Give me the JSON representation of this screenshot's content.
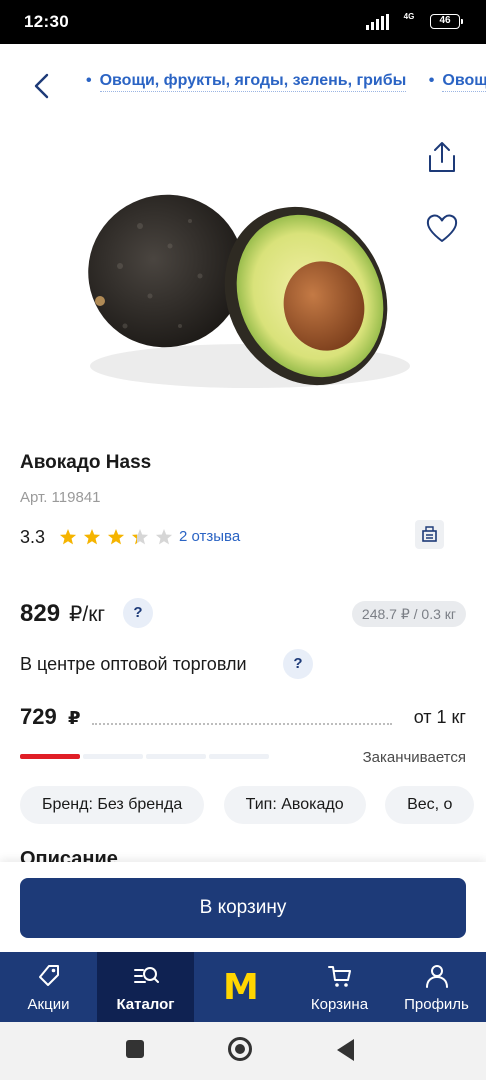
{
  "status": {
    "time": "12:30",
    "network": "4G",
    "battery": "46"
  },
  "breadcrumbs": [
    "Овощи, фрукты, ягоды, зелень, грибы",
    "Овощи"
  ],
  "product": {
    "title": "Авокадо Hass",
    "article": "Арт. 119841",
    "rating": "3.3",
    "rating_value": 3.3,
    "rating_max": 5,
    "reviews": "2 отзыва",
    "price": "829",
    "price_unit": "₽/кг",
    "price_per_weight": "248.7 ₽ / 0.3 кг",
    "wholesale_label": "В центре оптовой торговли",
    "wholesale_price": "729",
    "wholesale_currency": "₽",
    "wholesale_condition": "от 1 кг",
    "stock_label": "Заканчивается",
    "stock_level_segments": 1,
    "stock_total_segments": 4,
    "attributes": [
      "Бренд: Без бренда",
      "Тип: Авокадо",
      "Вес, о"
    ],
    "description_heading": "Описание"
  },
  "help_badge": "?",
  "actions": {
    "add_to_cart": "В корзину"
  },
  "tabs": [
    {
      "label": "Акции",
      "icon": "tag-icon"
    },
    {
      "label": "Каталог",
      "icon": "catalog-search-icon",
      "active": true
    },
    {
      "label": "",
      "icon": "metro-logo",
      "logo_text": "M"
    },
    {
      "label": "Корзина",
      "icon": "cart-icon"
    },
    {
      "label": "Профиль",
      "icon": "profile-icon"
    }
  ],
  "colors": {
    "primary": "#1d3a78",
    "link": "#2b64c4",
    "star": "#f5b400",
    "stock": "#e01e26",
    "logo": "#ffd500"
  }
}
